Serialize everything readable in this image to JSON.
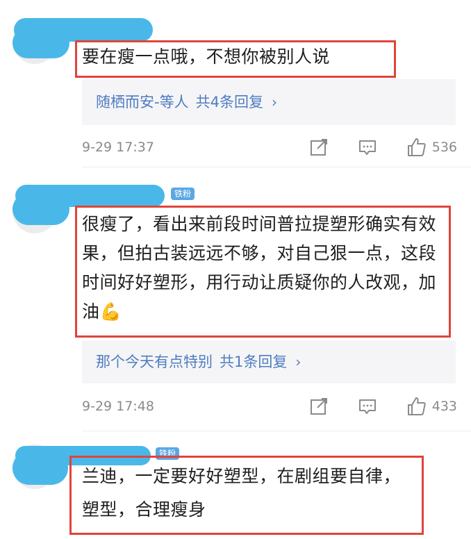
{
  "comments": [
    {
      "content": "要在瘦一点哦，不想你被别人说",
      "replies": {
        "names": "随栖而安-等人",
        "count": "共4条回复"
      },
      "time": "9-29 17:37",
      "likes": "536"
    },
    {
      "badge": "铁粉",
      "content": "很瘦了，看出来前段时间普拉提塑形确实有效果，但拍古装远远不够，对自己狠一点，这段时间好好塑形，用行动让质疑你的人改观，加油💪",
      "replies": {
        "names": "那个今天有点特别",
        "count": "共1条回复"
      },
      "time": "9-29 17:48",
      "likes": "433"
    },
    {
      "badge": "铁粉",
      "content": "兰迪，一定要好好塑型，在剧组要自律，塑型，合理瘦身"
    }
  ],
  "icons": {
    "share": "share-icon",
    "comment": "comment-icon",
    "like": "thumbs-up-icon",
    "chevron": "chevron-right-icon"
  },
  "colors": {
    "highlight": "#e0443a",
    "link": "#4f7cc0",
    "badge": "#5ba7e3",
    "avatar_mask": "#49b8e8"
  }
}
